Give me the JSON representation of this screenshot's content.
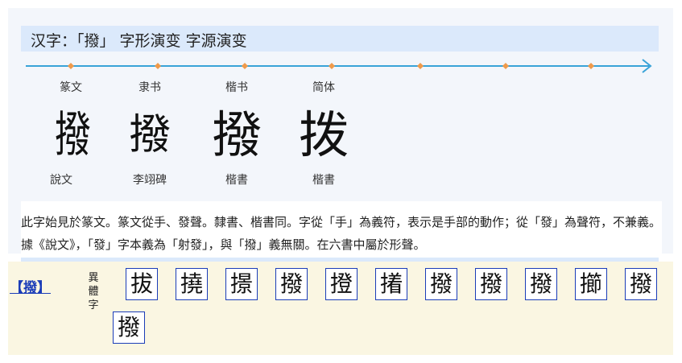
{
  "evolution": {
    "title": "汉字：「撥」 字形演变 字源演变",
    "stages": [
      {
        "label": "篆文",
        "glyph": "撥",
        "source": "說文"
      },
      {
        "label": "隶书",
        "glyph": "撥",
        "source": "李翊碑"
      },
      {
        "label": "楷书",
        "glyph": "撥",
        "source": "楷書"
      },
      {
        "label": "简体",
        "glyph": "拨",
        "source": "楷書"
      }
    ],
    "description": "此字始見於篆文。篆文從手、發聲。隸書、楷書同。字從「手」為義符，表示是手部的動作；從「發」為聲符，不兼義。據《說文》，「發」字本義為「射發」，與「撥」義無關。在六書中屬於形聲。",
    "timeline_color": "#3aa3d8",
    "marker_color": "#f09a4a"
  },
  "variants": {
    "headword": "【撥】",
    "label": "異體字",
    "chars": [
      "拔",
      "撓",
      "撔",
      "撥",
      "撜",
      "撯",
      "撥",
      "撥",
      "撥",
      "擳",
      "撥",
      "撥"
    ],
    "border_color": "#1b3db8"
  }
}
